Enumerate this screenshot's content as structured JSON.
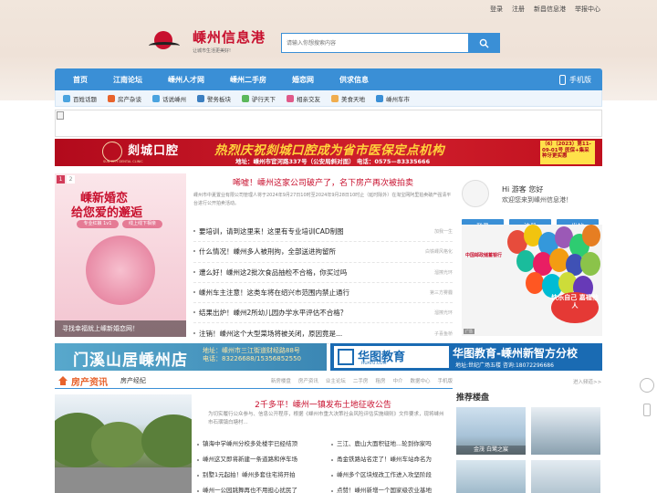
{
  "topbar": {
    "links": [
      "登录",
      "注册",
      "新昌信息港",
      "举报中心"
    ]
  },
  "logo": {
    "title": "嵊州信息港",
    "subtitle": "让城市生活更美好!"
  },
  "search": {
    "placeholder": "请输入你想搜索内容"
  },
  "nav": {
    "items": [
      "首页",
      "江南论坛",
      "嵊州人才网",
      "嵊州二手房",
      "婚恋网",
      "供求信息"
    ],
    "mobile_label": "手机版"
  },
  "subnav": {
    "items": [
      {
        "label": "百姓话题",
        "color": "#4aa3df"
      },
      {
        "label": "房产杂谈",
        "color": "#e8632c"
      },
      {
        "label": "话说嵊州",
        "color": "#4aa3df"
      },
      {
        "label": "警务板块",
        "color": "#3c7fc1"
      },
      {
        "label": "驴行天下",
        "color": "#5cb85c"
      },
      {
        "label": "相亲交友",
        "color": "#e05a8a"
      },
      {
        "label": "美食天地",
        "color": "#f0ad4e"
      },
      {
        "label": "嵊州车市",
        "color": "#3a8fd6"
      }
    ]
  },
  "dental_banner": {
    "name": "剡城口腔",
    "en": "SUN CITY DENTAL CLINIC",
    "headline": "热烈庆祝剡城口腔成为省市医保定点机构",
    "address": "地址：嵊州市官河路337号（公安局斜对面）  电话：0575—83335666",
    "tag": "（6）（2023）第11-09-01号 医保+集采 种牙更实惠"
  },
  "slider": {
    "pages": [
      "1",
      "2"
    ],
    "title_line1": "嵊新婚恋",
    "title_line2": "给您爱的邂逅",
    "pill1": "专业红娘 1v1",
    "pill2": "线上线下相亲",
    "caption": "寻找幸福就上嵊新婚恋网！"
  },
  "news": {
    "headline": "唏嘘！嵊州这家公司破产了，名下房产再次被拍卖",
    "summary": "嵊州市中夏置业有限公司管理人将于2024年9月27日10时至2024年9月28日10时止（延时除外）在淘宝网阿里拍卖破产强清平台进行公开拍卖活动。",
    "items": [
      {
        "title": "要培训，请到这里来！这里有专业培训CAD制图",
        "meta": "加我一生"
      },
      {
        "title": "什么情况！嵊州多人被刑拘，全部送进拘留所",
        "meta": "白铁嵊风格化"
      },
      {
        "title": "遭么好！嵊州这2批次食品抽检不合格，你买过吗",
        "meta": "溜擦光环"
      },
      {
        "title": "嵊州车主注意！这类车将在绍兴市范围内禁止通行",
        "meta": "第三方雾霾"
      },
      {
        "title": "结果出炉！嵊州2所幼儿园办学水平评估不合格？",
        "meta": "溜擦光环"
      },
      {
        "title": "注销！嵊州这个大型菜场将被关闭，原因竟是...",
        "meta": "子喜鱼桥"
      }
    ]
  },
  "user": {
    "hello": "Hi 游客 您好",
    "welcome": "欢迎您来到嵊州信息港！",
    "buttons": [
      "登录",
      "注册",
      "发帖"
    ]
  },
  "bank_ad": {
    "bank": "中国邮政储蓄银行",
    "slogan": "快乐自己 嘉福他人",
    "tag": "广告"
  },
  "house_banner": {
    "title": "门溪山居嵊州店",
    "addr_line1": "地址：嵊州市三江街道财经路88号",
    "addr_line2": "电话：83226688/15356852550"
  },
  "huatu_banner": {
    "name": "华图教育",
    "url": "HUATU.COM",
    "title": "华图教育-嵊州新智方分校",
    "address": "地址:世纪广场五楼  咨询:18072296686"
  },
  "house_section": {
    "title": "房产资讯",
    "tab": "房产经纪",
    "links": [
      "新房楼盘",
      "房产资讯",
      "业主论坛",
      "二手房",
      "租房",
      "中介",
      "数据中心",
      "手机版"
    ],
    "more": "进入频道>>",
    "feature_title": "2千多平！嵊州一镇发布土地征收公告",
    "feature_summary": "为切实履行公众参与、信息公开程序，根据《嵊州市重大决策社会风险评估实施细则》文件要求，现将嵊州市石璜镇白塘村...",
    "items": [
      "镇海中学嵊州分校多处楼宇已经结顶",
      "三江、鹿山大面积征地...轮到你家吗",
      "嵊州这又即将新建一条道路和停车场",
      "甬金铁路站名定了！嵊州车站命名为",
      "别墅1元起拍！嵊州多套住宅将开拍",
      "嵊州多个区块规改工作进入攻坚阶段",
      "嵊州一公园跳舞再也不用担心扰民了",
      "点赞！嵊州新增一个国家级农业基地"
    ]
  },
  "recommend": {
    "title": "推荐楼盘",
    "cards": [
      "金茂 白鹭之宸",
      "",
      "",
      ""
    ]
  },
  "float_icons": [
    "wechat-icon",
    "phone-icon"
  ]
}
